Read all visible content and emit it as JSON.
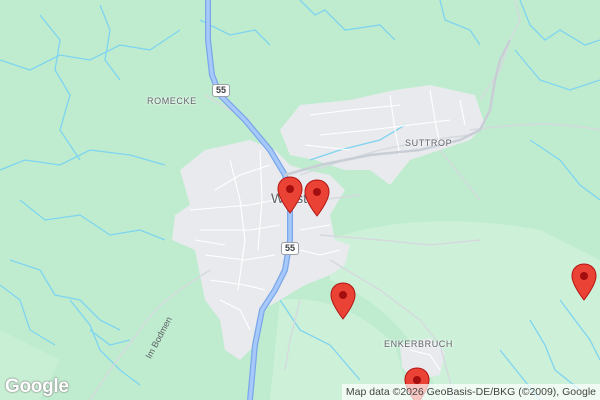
{
  "map": {
    "places": {
      "romecke": "ROMECKE",
      "suttrop": "SUTTROP",
      "enkerbruch": "ENKERBRUCH"
    },
    "town": "Warstein",
    "road_shield_top": "55",
    "road_shield_center": "55",
    "street_label": "Im Bodmen",
    "attribution": "Map data ©2026 GeoBasis-DE/BKG (©2009), Google",
    "logo": "Google",
    "colors": {
      "forest": "#bfeccf",
      "urban": "#e8eaed",
      "highway": "#8ab4f8",
      "stream": "#7ed4f0",
      "marker": "#ea4335"
    }
  }
}
